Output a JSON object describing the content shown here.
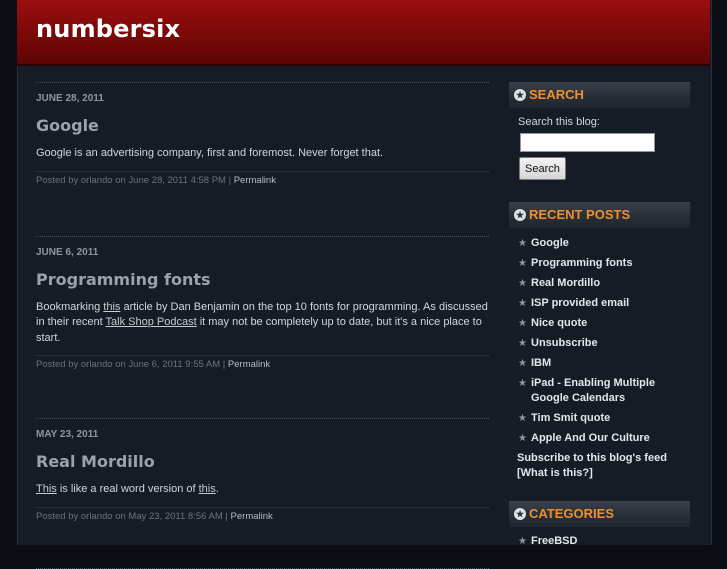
{
  "site": {
    "title": "numbersix"
  },
  "posts": [
    {
      "date": "JUNE 28, 2011",
      "title": "Google",
      "body": "Google is an advertising company, first and foremost. Never forget that.",
      "meta": "Posted by orlando on June 28, 2011 4:58 PM | ",
      "permalink": "Permalink"
    },
    {
      "date": "JUNE 6, 2011",
      "title": "Programming fonts",
      "body_parts": {
        "p1": "Bookmarking ",
        "link1": "this",
        "p2": " article by Dan Benjamin on the top 10 fonts for programming. As discussed in their recent ",
        "link2": "Talk Shop Podcast",
        "p3": " it may not be completely up to date, but it's a nice place to start."
      },
      "meta": "Posted by orlando on June 6, 2011 9:55 AM | ",
      "permalink": "Permalink"
    },
    {
      "date": "MAY 23, 2011",
      "title": "Real Mordillo",
      "body_parts": {
        "link1": "This",
        "p1": " is like a real word version of ",
        "link2": "this",
        "p2": "."
      },
      "meta": "Posted by orlando on May 23, 2011 8:56 AM | ",
      "permalink": "Permalink"
    }
  ],
  "sidebar": {
    "search": {
      "heading": "SEARCH",
      "label": "Search this blog:",
      "input_value": "",
      "button": "Search"
    },
    "recent": {
      "heading": "RECENT POSTS",
      "items": [
        "Google",
        "Programming fonts",
        "Real Mordillo",
        "ISP provided email",
        "Nice quote",
        "Unsubscribe",
        "IBM",
        "iPad - Enabling Multiple Google Calendars",
        "Tim Smit quote",
        "Apple And Our Culture"
      ],
      "feed_text": "Subscribe to this blog's feed",
      "feed_help": "[What is this?]"
    },
    "categories": {
      "heading": "CATEGORIES",
      "items": [
        "FreeBSD"
      ]
    }
  },
  "colors": {
    "header_red": "#8b0b0b",
    "accent_orange": "#ee8f2f",
    "background": "#151c25"
  }
}
